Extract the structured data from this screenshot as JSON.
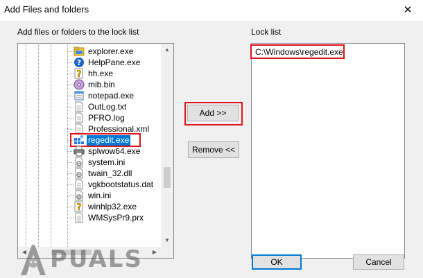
{
  "window": {
    "title": "Add Files and folders",
    "close_glyph": "✕"
  },
  "left_panel": {
    "label": "Add files or folders to the lock list"
  },
  "files": [
    {
      "name": "explorer.exe",
      "icon": "folder-icon"
    },
    {
      "name": "HelpPane.exe",
      "icon": "help-icon"
    },
    {
      "name": "hh.exe",
      "icon": "help-file-icon"
    },
    {
      "name": "mib.bin",
      "icon": "disc-icon"
    },
    {
      "name": "notepad.exe",
      "icon": "notepad-icon"
    },
    {
      "name": "OutLog.txt",
      "icon": "text-file-icon"
    },
    {
      "name": "PFRO.log",
      "icon": "text-file-icon"
    },
    {
      "name": "Professional.xml",
      "icon": "text-file-icon"
    },
    {
      "name": "regedit.exe",
      "icon": "registry-icon",
      "selected": true
    },
    {
      "name": "splwow64.exe",
      "icon": "printer-icon"
    },
    {
      "name": "system.ini",
      "icon": "settings-file-icon"
    },
    {
      "name": "twain_32.dll",
      "icon": "settings-file-icon"
    },
    {
      "name": "vgkbootstatus.dat",
      "icon": "text-file-icon"
    },
    {
      "name": "win.ini",
      "icon": "settings-file-icon"
    },
    {
      "name": "winhlp32.exe",
      "icon": "help-file-icon"
    },
    {
      "name": "WMSysPr9.prx",
      "icon": "text-file-icon"
    }
  ],
  "buttons": {
    "add": "Add >>",
    "remove": "Remove <<",
    "ok": "OK",
    "cancel": "Cancel"
  },
  "right_panel": {
    "label": "Lock list",
    "items": [
      "C:\\Windows\\regedit.exe"
    ]
  },
  "scroll": {
    "up": "▲",
    "down": "▼",
    "left": "◀",
    "right": "▶"
  },
  "watermark": {
    "text": "PUALS",
    "brand": "Appuals"
  },
  "colors": {
    "highlight": "#e0121a",
    "selection": "#0078d7"
  }
}
